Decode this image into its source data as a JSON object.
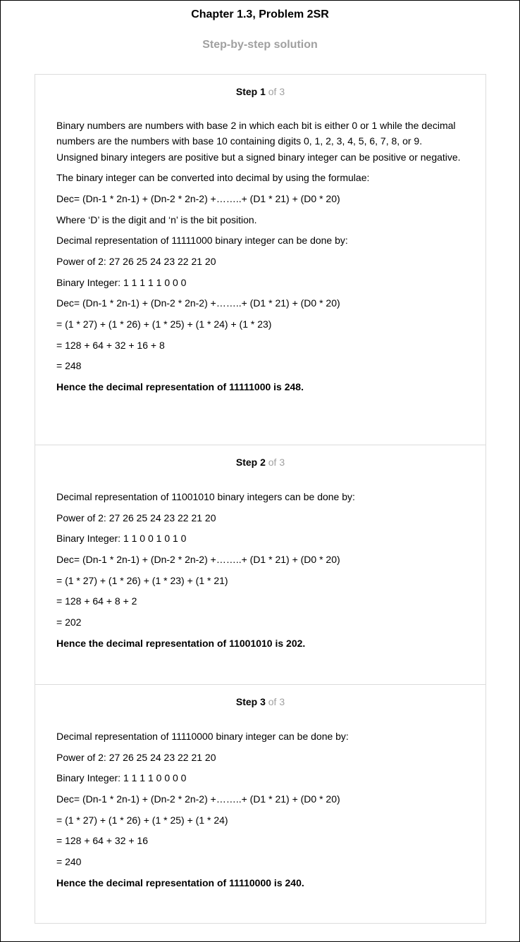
{
  "header": {
    "title": "Chapter 1.3, Problem 2SR",
    "subtitle": "Step-by-step solution"
  },
  "steps": [
    {
      "label": "Step 1",
      "of": "of 3",
      "lines": [
        "Binary numbers are numbers with base 2 in which each bit is either 0 or 1 while the decimal numbers are the numbers with base 10 containing digits 0, 1, 2, 3, 4, 5, 6, 7, 8, or 9. Unsigned binary integers are positive but a signed binary integer can be positive or negative.",
        "The binary integer can be converted into decimal by using the formulae:",
        "Dec= (Dn-1 * 2n-1) + (Dn-2 * 2n-2) +……..+ (D1 * 21) + (D0 * 20)",
        "Where ‘D’ is the digit and ‘n’ is the bit position.",
        "Decimal representation of 11111000 binary integer can be done by:",
        "Power of 2: 27 26 25 24 23 22 21 20",
        "Binary Integer: 1 1 1 1 1 0 0 0",
        "Dec= (Dn-1 * 2n-1) + (Dn-2 * 2n-2) +……..+ (D1 * 21) + (D0 * 20)",
        "= (1 * 27) + (1 * 26) + (1 * 25) + (1 * 24) + (1 * 23)",
        "= 128 + 64 + 32 + 16 + 8",
        "= 248"
      ],
      "conclusion": "Hence the decimal representation of 11111000 is 248."
    },
    {
      "label": "Step 2",
      "of": "of 3",
      "lines": [
        "Decimal representation of 11001010 binary integers can be done by:",
        "Power of 2: 27 26 25 24 23 22 21 20",
        "Binary Integer: 1 1 0 0 1 0 1 0",
        "Dec= (Dn-1 * 2n-1) + (Dn-2 * 2n-2) +……..+ (D1 * 21) + (D0 * 20)",
        "= (1 * 27) + (1 * 26) + (1 * 23) + (1 * 21)",
        "= 128 + 64 + 8 + 2",
        "= 202"
      ],
      "conclusion": "Hence the decimal representation of 11001010 is 202."
    },
    {
      "label": "Step 3",
      "of": "of 3",
      "lines": [
        "Decimal representation of 11110000 binary integer can be done by:",
        "Power of 2: 27 26 25 24 23 22 21 20",
        "Binary Integer: 1 1 1 1 0 0 0 0",
        "Dec= (Dn-1 * 2n-1) + (Dn-2 * 2n-2) +……..+ (D1 * 21) + (D0 * 20)",
        "= (1 * 27) + (1 * 26) + (1 * 25) + (1 * 24)",
        "= 128 + 64 + 32 + 16",
        "= 240"
      ],
      "conclusion": "Hence the decimal representation of 11110000 is 240."
    }
  ]
}
